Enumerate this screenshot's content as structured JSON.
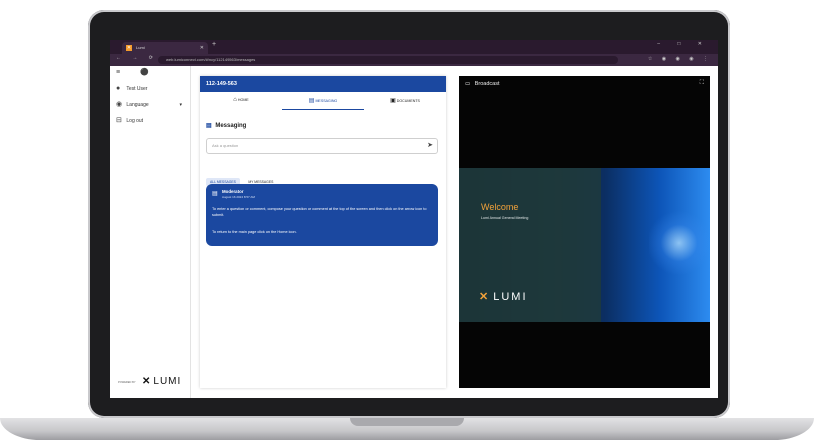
{
  "browser": {
    "tab_title": "Lumi",
    "url": "web.lumiconnect.com/#/ncy/112149563/messages",
    "new_tab_label": "+",
    "window_controls": "– □ ✕",
    "nav_controls": "← → ⟳",
    "extensions": "☆ ◉ ◉ ◉ ⋮"
  },
  "sidebar": {
    "user": "Test User",
    "language": "Language",
    "logout": "Log out",
    "powered_by": "POWERED BY",
    "brand": "LUMI"
  },
  "meeting": {
    "id": "112-149-563",
    "tabs": [
      {
        "label": "HOME",
        "icon": "home-icon"
      },
      {
        "label": "MESSAGING",
        "icon": "chat-icon"
      },
      {
        "label": "DOCUMENTS",
        "icon": "document-icon"
      }
    ],
    "section_title": "Messaging",
    "ask_placeholder": "Ask a question",
    "filters": [
      "ALL MESSAGES",
      "MY MESSAGES"
    ],
    "message": {
      "author": "Moderator",
      "time": "August 16 2024 8:57 AM",
      "line1": "To enter a question or comment, compose your question or comment at the top of the screen and then click on the arrow icon to submit.",
      "line2": "To return to the main page click on the Home icon."
    }
  },
  "broadcast": {
    "title": "Broadcast",
    "welcome": "Welcome",
    "subtitle": "Lumi Annual General Meeting",
    "logo_text": "LUMI"
  },
  "colors": {
    "accent": "#1b48a0",
    "brand_orange": "#f2a23a",
    "browser_frame": "#3b2841"
  }
}
